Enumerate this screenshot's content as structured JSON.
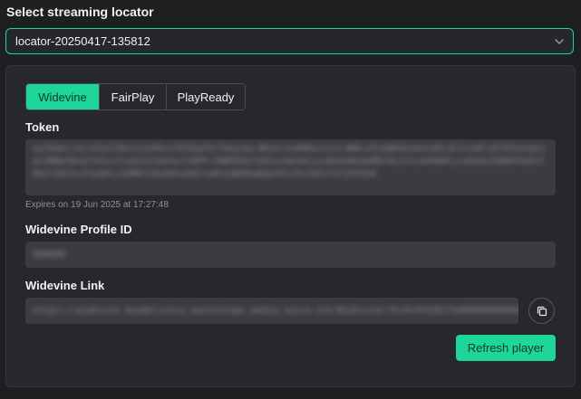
{
  "header": {
    "title": "Select streaming locator"
  },
  "locator_select": {
    "value": "locator-20250417-135812",
    "icon": "chevron-down-icon"
  },
  "drm_tabs": [
    {
      "label": "Widevine",
      "active": true
    },
    {
      "label": "FairPlay",
      "active": false
    },
    {
      "label": "PlayReady",
      "active": false
    }
  ],
  "token": {
    "label": "Token",
    "expires": "Expires on 19 Jun 2025 at 17:27:48"
  },
  "profile": {
    "label": "Widevine Profile ID"
  },
  "link": {
    "label": "Widevine Link",
    "copy_icon": "copy-icon"
  },
  "actions": {
    "refresh_label": "Refresh player"
  },
  "colors": {
    "accent": "#1ed69a",
    "background": "#1e1f21",
    "panel": "#26282b",
    "field": "#3a3c40"
  }
}
